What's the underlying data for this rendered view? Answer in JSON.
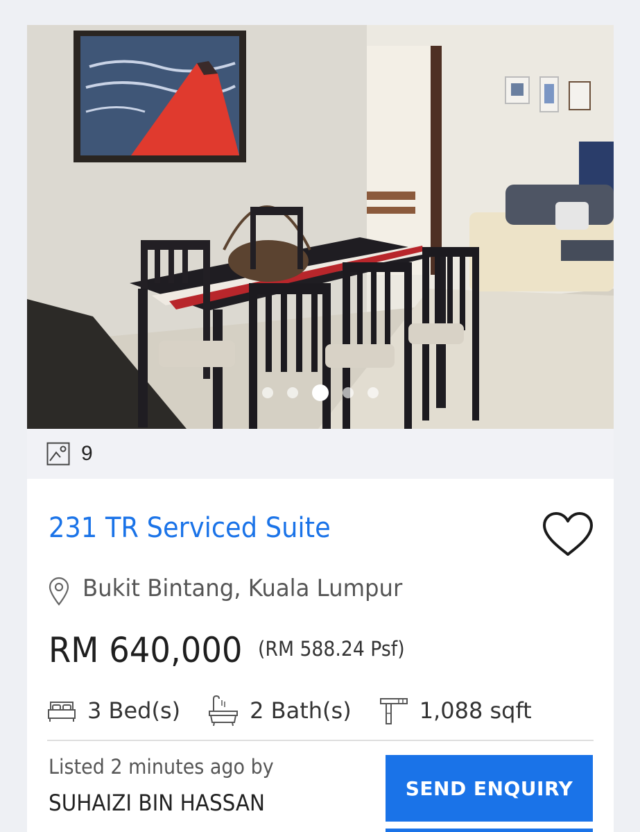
{
  "listing": {
    "photo_count": "9",
    "carousel": {
      "total": 5,
      "active_index": 2
    },
    "title": "231 TR Serviced Suite",
    "location": "Bukit Bintang, Kuala Lumpur",
    "price": "RM 640,000",
    "price_psf": "(RM 588.24 Psf)",
    "features": {
      "beds": "3  Bed(s)",
      "baths": "2  Bath(s)",
      "size": "1,088 sqft"
    },
    "listed_text": "Listed 2 minutes ago by",
    "agent_name": "SUHAIZI BIN HASSAN",
    "enquiry_label": "SEND ENQUIRY",
    "favourited": false
  },
  "colors": {
    "accent": "#1a73e8",
    "text_dark": "#1e1e1e",
    "text_muted": "#555555",
    "photo_bar_bg": "#f1f2f6"
  },
  "icons": {
    "photo_count": "image-icon",
    "favourite": "heart-outline-icon",
    "location": "map-pin-icon",
    "beds": "bed-icon",
    "baths": "bathtub-icon",
    "size": "area-icon"
  }
}
